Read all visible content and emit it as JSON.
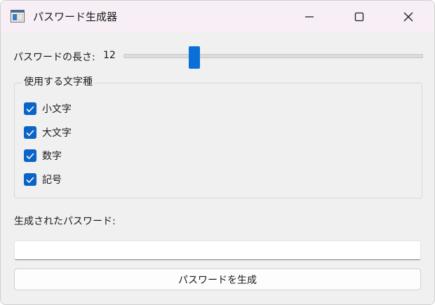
{
  "window": {
    "title": "パスワード生成器"
  },
  "length": {
    "label": "パスワードの長さ:",
    "value": "12",
    "slider_fraction": 0.24
  },
  "charset_group": {
    "legend": "使用する文字種",
    "options": [
      {
        "label": "小文字",
        "checked": true
      },
      {
        "label": "大文字",
        "checked": true
      },
      {
        "label": "数字",
        "checked": true
      },
      {
        "label": "記号",
        "checked": true
      }
    ]
  },
  "output": {
    "label": "生成されたパスワード:",
    "value": ""
  },
  "generate_button": {
    "label": "パスワードを生成"
  },
  "colors": {
    "accent": "#0a6fd6",
    "checkbox": "#0a64c8",
    "titlebar": "#f7eff5",
    "background": "#f0f0f0"
  },
  "icons": {
    "app": "app-window-icon",
    "minimize": "minimize-icon",
    "maximize": "maximize-icon",
    "close": "close-icon",
    "check": "checkmark-icon"
  }
}
